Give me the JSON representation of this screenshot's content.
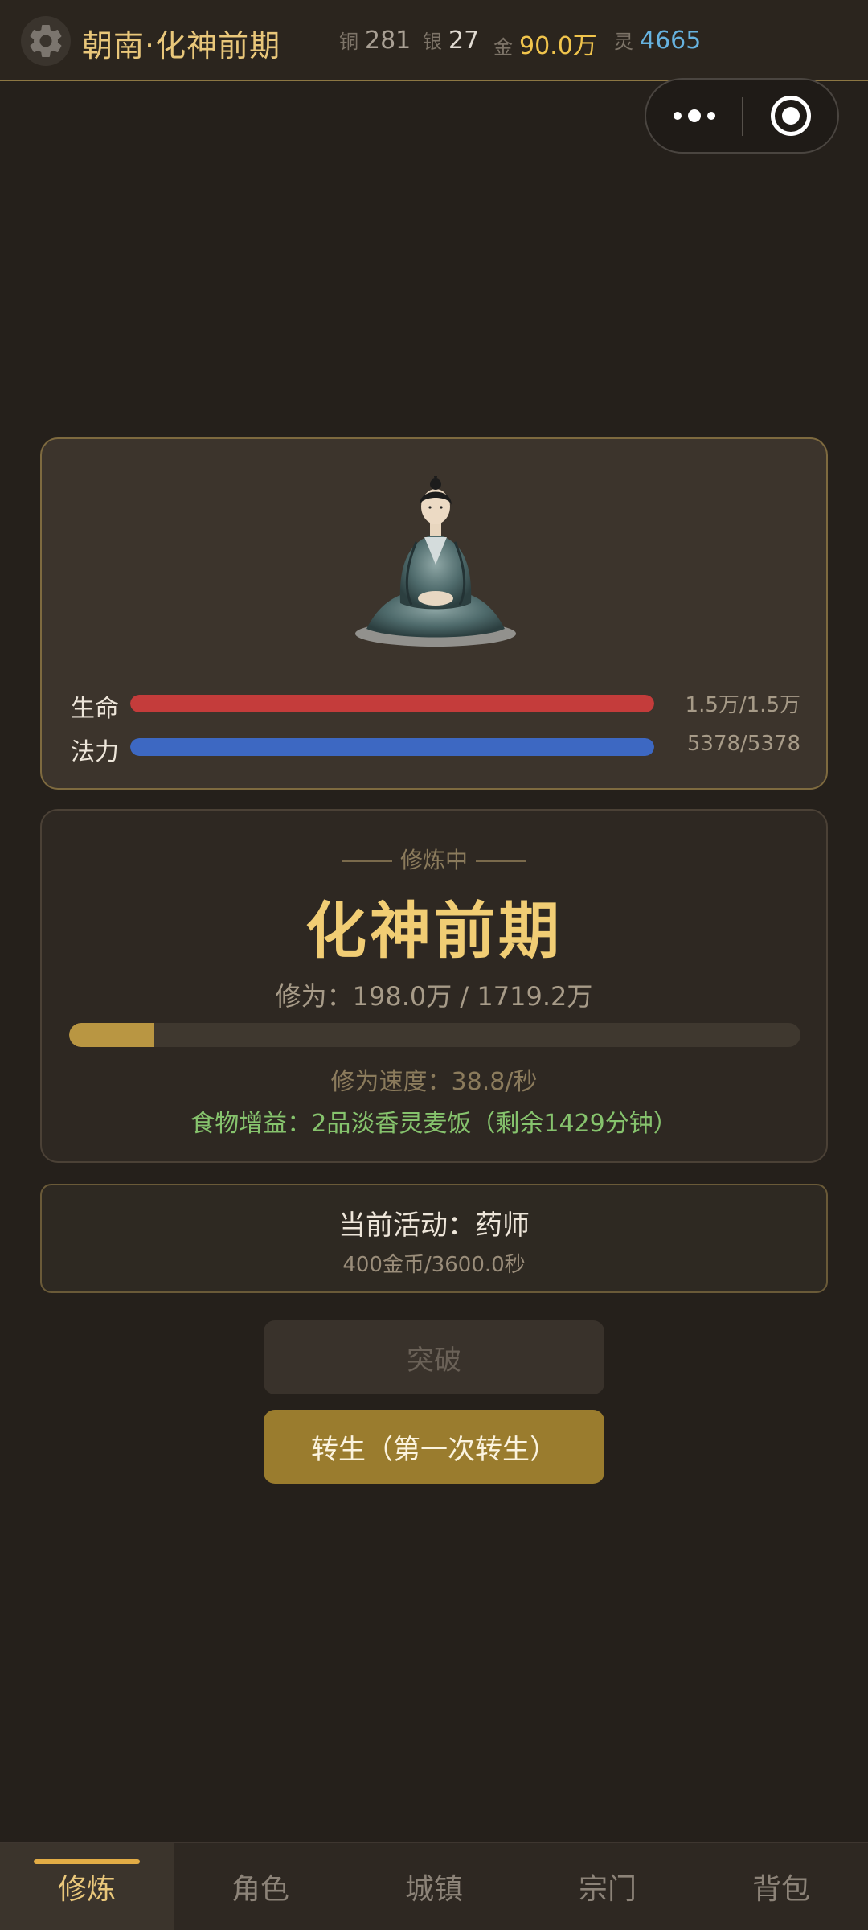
{
  "header": {
    "title": "朝南·化神前期",
    "currencies": {
      "copper": {
        "label": "铜",
        "value": "281"
      },
      "silver": {
        "label": "银",
        "value": "27"
      },
      "gold": {
        "label": "金",
        "value": "90.0万"
      },
      "spirit": {
        "label": "灵",
        "value": "4665"
      }
    }
  },
  "character": {
    "hp": {
      "label": "生命",
      "value": "1.5万/1.5万",
      "fraction": 1.0
    },
    "mp": {
      "label": "法力",
      "value": "5378/5378",
      "fraction": 1.0
    }
  },
  "cultivation": {
    "status": "修炼中",
    "realm": "化神前期",
    "xiuwei": "修为：198.0万 / 1719.2万",
    "progress_fraction": 0.115,
    "speed": "修为速度：38.8/秒",
    "food_buff": "食物增益：2品淡香灵麦饭（剩余1429分钟）"
  },
  "activity": {
    "title": "当前活动：药师",
    "reward": "400金币/3600.0秒"
  },
  "buttons": {
    "breakthrough": "突破",
    "rebirth": "转生（第一次转生）"
  },
  "nav": {
    "items": [
      {
        "label": "修炼",
        "active": true
      },
      {
        "label": "角色",
        "active": false
      },
      {
        "label": "城镇",
        "active": false
      },
      {
        "label": "宗门",
        "active": false
      },
      {
        "label": "背包",
        "active": false
      }
    ]
  },
  "colors": {
    "accent": "#e9c77a",
    "hp": "#c43c3b",
    "mp": "#3d68c2",
    "exp": "#b99642",
    "food": "#86c36d"
  }
}
